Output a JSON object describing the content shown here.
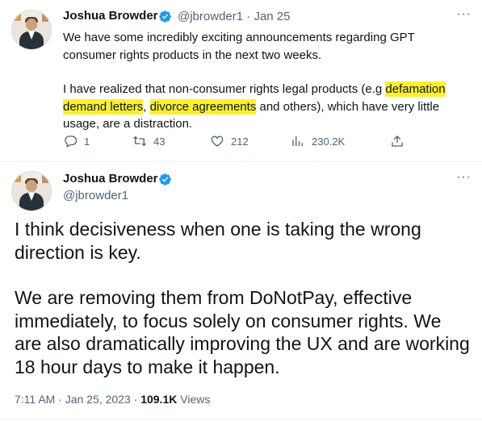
{
  "tweet1": {
    "author_name": "Joshua Browder",
    "handle": "@jbrowder1",
    "separator": "·",
    "date": "Jan 25",
    "text_para1": "We have some incredibly exciting announcements regarding GPT consumer rights products in the next two weeks.",
    "text_para2_pre": "I have realized that non-consumer rights legal products (e.g ",
    "highlight1": "defamation demand letters",
    "text_para2_mid": ", ",
    "highlight2": "divorce agreements",
    "text_para2_post": " and others), which have very little usage, are a distraction.",
    "replies": "1",
    "retweets": "43",
    "likes": "212",
    "views": "230.2K"
  },
  "tweet2": {
    "author_name": "Joshua Browder",
    "handle": "@jbrowder1",
    "text_para1": "I think decisiveness when one is taking the wrong direction is key.",
    "text_para2": "We are removing them from DoNotPay, effective immediately, to focus solely on consumer rights. We are also dramatically improving the UX and are working 18 hour days to make it happen.",
    "time": "7:11 AM",
    "dot": "·",
    "date": "Jan 25, 2023",
    "views_count": "109.1K",
    "views_label": "Views"
  },
  "colors": {
    "highlight": "#fdf02a",
    "verified": "#1d9bf0",
    "secondary_text": "#536471"
  },
  "icons": [
    "verified-badge-icon",
    "more-options-icon",
    "reply-icon",
    "retweet-icon",
    "like-icon",
    "views-icon",
    "share-icon"
  ]
}
